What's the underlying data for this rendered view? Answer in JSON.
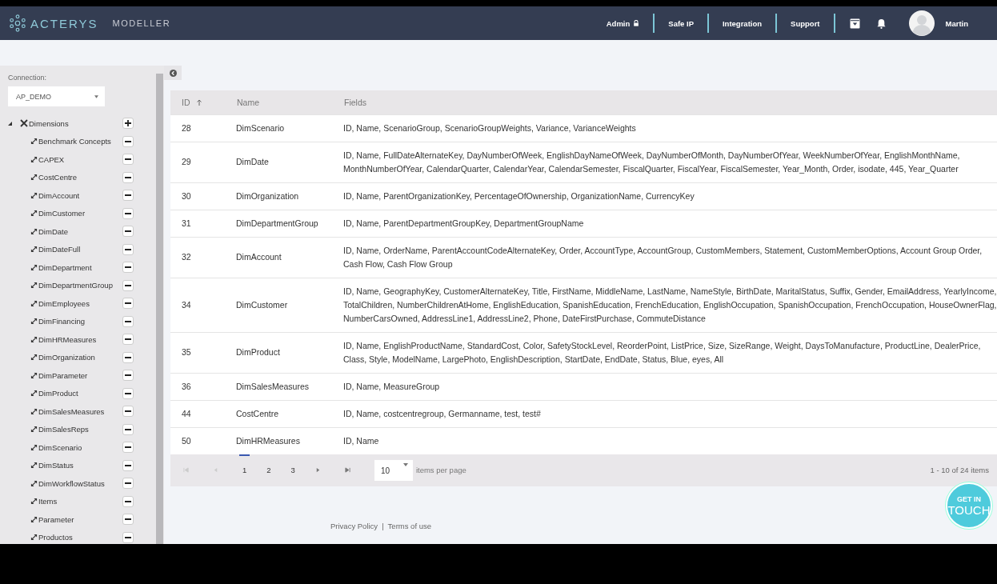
{
  "header": {
    "brand": "ACTERYS",
    "product": "MODELLER",
    "nav": [
      {
        "label": "Admin",
        "locked": true
      },
      {
        "label": "Safe IP",
        "locked": false
      },
      {
        "label": "Integration",
        "locked": false
      },
      {
        "label": "Support",
        "locked": false
      }
    ],
    "user": "Martin"
  },
  "sidebar": {
    "connection_label": "Connection:",
    "connection": "AP_DEMO",
    "tree": [
      {
        "label": "Dimensions",
        "expanded": true,
        "children": [
          {
            "label": "Benchmark Concepts"
          },
          {
            "label": "CAPEX"
          },
          {
            "label": "CostCentre"
          },
          {
            "label": "DimAccount"
          },
          {
            "label": "DimCustomer"
          },
          {
            "label": "DimDate"
          },
          {
            "label": "DimDateFull"
          },
          {
            "label": "DimDepartment"
          },
          {
            "label": "DimDepartmentGroup"
          },
          {
            "label": "DimEmployees"
          },
          {
            "label": "DimFinancing"
          },
          {
            "label": "DimHRMeasures"
          },
          {
            "label": "DimOrganization"
          },
          {
            "label": "DimParameter"
          },
          {
            "label": "DimProduct"
          },
          {
            "label": "DimSalesMeasures"
          },
          {
            "label": "DimSalesReps"
          },
          {
            "label": "DimScenario"
          },
          {
            "label": "DimStatus"
          },
          {
            "label": "DimWorkflowStatus"
          },
          {
            "label": "Items"
          },
          {
            "label": "Parameter"
          },
          {
            "label": "Productos"
          }
        ]
      }
    ]
  },
  "table": {
    "columns": [
      {
        "label": "ID",
        "sorted": true
      },
      {
        "label": "Name",
        "sorted": false
      },
      {
        "label": "Fields",
        "sorted": false
      }
    ],
    "rows": [
      [
        "28",
        "DimScenario",
        "ID, Name, ScenarioGroup, ScenarioGroupWeights, Variance, VarianceWeights"
      ],
      [
        "29",
        "DimDate",
        "ID, Name, FullDateAlternateKey, DayNumberOfWeek, EnglishDayNameOfWeek, DayNumberOfMonth, DayNumberOfYear, WeekNumberOfYear, EnglishMonthName, MonthNumberOfYear, CalendarQuarter, CalendarYear, CalendarSemester, FiscalQuarter, FiscalYear, FiscalSemester, Year_Month, Order, isodate, 445, Year_Quarter"
      ],
      [
        "30",
        "DimOrganization",
        "ID, Name, ParentOrganizationKey, PercentageOfOwnership, OrganizationName, CurrencyKey"
      ],
      [
        "31",
        "DimDepartmentGroup",
        "ID, Name, ParentDepartmentGroupKey, DepartmentGroupName"
      ],
      [
        "32",
        "DimAccount",
        "ID, Name, OrderName, ParentAccountCodeAlternateKey, Order, AccountType, AccountGroup, CustomMembers, Statement, CustomMemberOptions, Account Group Order, Cash Flow, Cash Flow Group"
      ],
      [
        "34",
        "DimCustomer",
        "ID, Name, GeographyKey, CustomerAlternateKey, Title, FirstName, MiddleName, LastName, NameStyle, BirthDate, MaritalStatus, Suffix, Gender, EmailAddress, YearlyIncome, TotalChildren, NumberChildrenAtHome, EnglishEducation, SpanishEducation, FrenchEducation, EnglishOccupation, SpanishOccupation, FrenchOccupation, HouseOwnerFlag, NumberCarsOwned, AddressLine1, AddressLine2, Phone, DateFirstPurchase, CommuteDistance"
      ],
      [
        "35",
        "DimProduct",
        "ID, Name, EnglishProductName, StandardCost, Color, SafetyStockLevel, ReorderPoint, ListPrice, Size, SizeRange, Weight, DaysToManufacture, ProductLine, DealerPrice, Class, Style, ModelName, LargePhoto, EnglishDescription, StartDate, EndDate, Status, Blue, eyes, All"
      ],
      [
        "36",
        "DimSalesMeasures",
        "ID, Name, MeasureGroup"
      ],
      [
        "44",
        "CostCentre",
        "ID, Name, costcentregroup, Germanname, test, test#"
      ],
      [
        "50",
        "DimHRMeasures",
        "ID, Name"
      ]
    ]
  },
  "pager": {
    "pages": [
      {
        "label": "1",
        "selected": true
      },
      {
        "label": "2",
        "selected": false
      },
      {
        "label": "3",
        "selected": false
      }
    ],
    "page_size": "10",
    "page_size_label": "items per page",
    "summary": "1 - 10 of 24 items"
  },
  "footer": {
    "links": [
      "Privacy Policy",
      "Terms of use"
    ],
    "separator": "|"
  },
  "contact_button": {
    "line1": "GET IN",
    "line2": "TOUCH"
  }
}
